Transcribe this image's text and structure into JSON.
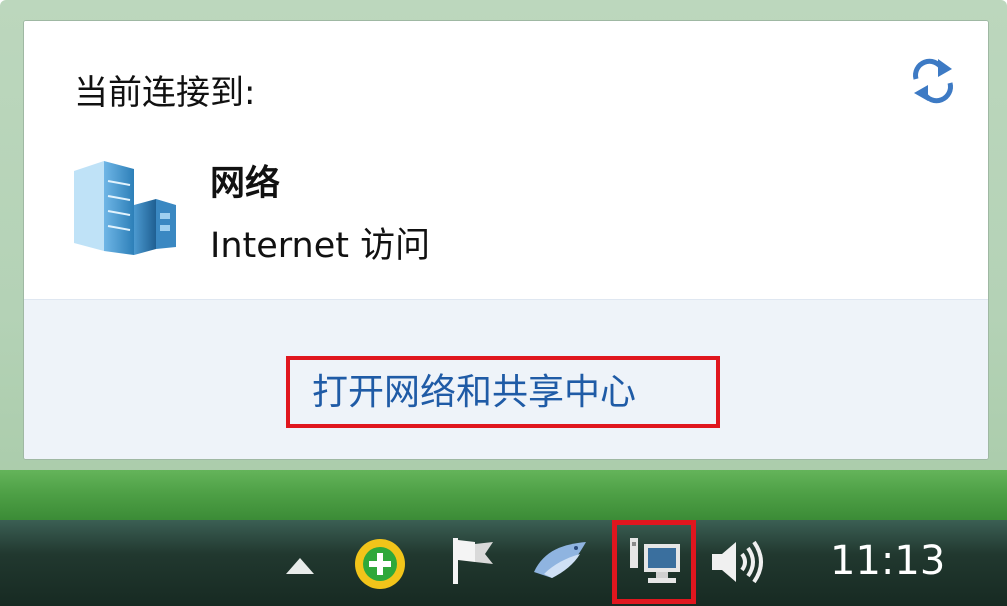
{
  "popup": {
    "heading": "当前连接到:",
    "network": {
      "name": "网络",
      "access": "Internet 访问"
    },
    "open_center_link": "打开网络和共享中心",
    "refresh_icon": "refresh-arrows-icon",
    "network_icon": "network-server-icon"
  },
  "taskbar": {
    "tray_icons": [
      "show-hidden-icons-arrow",
      "green-plus-app-icon",
      "action-center-flag-icon",
      "bird-app-icon",
      "network-icon",
      "volume-icon"
    ],
    "clock": "11:13"
  },
  "colors": {
    "link": "#1f5ba6",
    "highlight": "#e0161e",
    "taskbar": "#1c3229"
  }
}
